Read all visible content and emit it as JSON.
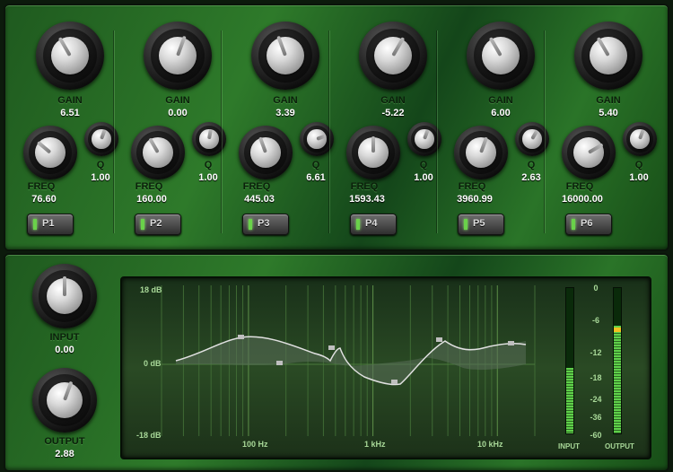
{
  "eq_bands": [
    {
      "gain_label": "GAIN",
      "gain_value": "6.51",
      "freq_label": "FREQ",
      "freq_value": "76.60",
      "q_label": "Q",
      "q_value": "1.00",
      "preset_label": "P1"
    },
    {
      "gain_label": "GAIN",
      "gain_value": "0.00",
      "freq_label": "FREQ",
      "freq_value": "160.00",
      "q_label": "Q",
      "q_value": "1.00",
      "preset_label": "P2"
    },
    {
      "gain_label": "GAIN",
      "gain_value": "3.39",
      "freq_label": "FREQ",
      "freq_value": "445.03",
      "q_label": "Q",
      "q_value": "6.61",
      "preset_label": "P3"
    },
    {
      "gain_label": "GAIN",
      "gain_value": "-5.22",
      "freq_label": "FREQ",
      "freq_value": "1593.43",
      "q_label": "Q",
      "q_value": "1.00",
      "preset_label": "P4"
    },
    {
      "gain_label": "GAIN",
      "gain_value": "6.00",
      "freq_label": "FREQ",
      "freq_value": "3960.99",
      "q_label": "Q",
      "q_value": "2.63",
      "preset_label": "P5"
    },
    {
      "gain_label": "GAIN",
      "gain_value": "5.40",
      "freq_label": "FREQ",
      "freq_value": "16000.00",
      "q_label": "Q",
      "q_value": "1.00",
      "preset_label": "P6"
    }
  ],
  "input_knob": {
    "label": "INPUT",
    "value": "0.00"
  },
  "output_knob": {
    "label": "OUTPUT",
    "value": "2.88"
  },
  "graph": {
    "db_labels": [
      "18 dB",
      "0 dB",
      "-18 dB"
    ],
    "freq_labels": [
      "100 Hz",
      "1 kHz",
      "10 kHz"
    ]
  },
  "meters": {
    "input_label": "INPUT",
    "output_label": "OUTPUT",
    "scale": [
      "0",
      "-6",
      "-12",
      "-18",
      "-24",
      "-36",
      "-60"
    ],
    "input_level": 0.45,
    "output_level": 0.74
  },
  "colors": {
    "panel": "#2e7a2a",
    "curve": "#e0e0e0",
    "meter": "#5fd04a",
    "meter_peak": "#f0c020"
  }
}
